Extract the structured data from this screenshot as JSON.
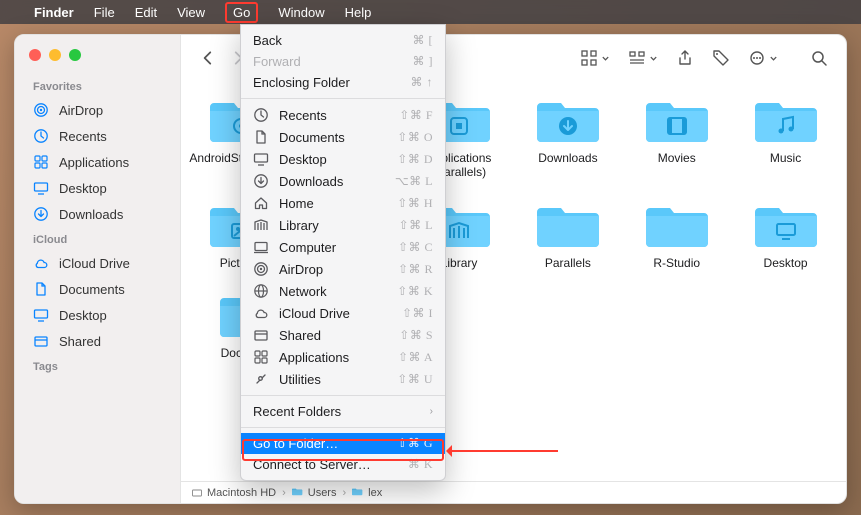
{
  "menubar": {
    "app": "Finder",
    "items": [
      "File",
      "Edit",
      "View",
      "Go",
      "Window",
      "Help"
    ]
  },
  "sidebar": {
    "favorites_label": "Favorites",
    "favorites": [
      {
        "icon": "airdrop",
        "label": "AirDrop"
      },
      {
        "icon": "clock",
        "label": "Recents"
      },
      {
        "icon": "apps",
        "label": "Applications"
      },
      {
        "icon": "desktop",
        "label": "Desktop"
      },
      {
        "icon": "download",
        "label": "Downloads"
      }
    ],
    "icloud_label": "iCloud",
    "icloud": [
      {
        "icon": "cloud",
        "label": "iCloud Drive"
      },
      {
        "icon": "doc",
        "label": "Documents"
      },
      {
        "icon": "desktop",
        "label": "Desktop"
      },
      {
        "icon": "shared",
        "label": "Shared"
      }
    ],
    "tags_label": "Tags"
  },
  "grid": {
    "row1": [
      {
        "glyph": "gear",
        "label": "AndroidStudioProjects"
      },
      {
        "glyph": "gear",
        "label": ""
      },
      {
        "glyph": "app",
        "label": "Applications (Parallels)"
      },
      {
        "glyph": "download",
        "label": "Downloads"
      },
      {
        "glyph": "movie",
        "label": "Movies"
      },
      {
        "glyph": "music",
        "label": "Music"
      }
    ],
    "row2": [
      {
        "glyph": "photo",
        "label": "Pictures"
      },
      {
        "glyph": "gear",
        "label": ""
      },
      {
        "glyph": "library",
        "label": "Library"
      },
      {
        "glyph": "none",
        "label": "Parallels"
      },
      {
        "glyph": "none",
        "label": "R-Studio"
      },
      {
        "glyph": "desktop",
        "label": "Desktop"
      }
    ],
    "row3": [
      {
        "glyph": "doc",
        "label": "Documents"
      },
      {
        "glyph": "gear",
        "label": ""
      }
    ]
  },
  "pathbar": {
    "items": [
      "Macintosh HD",
      "Users",
      "lex"
    ]
  },
  "menu": {
    "top": [
      {
        "label": "Back",
        "sc": "⌘ ["
      },
      {
        "label": "Forward",
        "sc": "⌘ ]",
        "dis": true
      },
      {
        "label": "Enclosing Folder",
        "sc": "⌘ ↑"
      }
    ],
    "places": [
      {
        "icon": "clock",
        "label": "Recents",
        "sc": "⇧⌘ F"
      },
      {
        "icon": "doc",
        "label": "Documents",
        "sc": "⇧⌘ O"
      },
      {
        "icon": "desktop",
        "label": "Desktop",
        "sc": "⇧⌘ D"
      },
      {
        "icon": "download",
        "label": "Downloads",
        "sc": "⌥⌘ L"
      },
      {
        "icon": "home",
        "label": "Home",
        "sc": "⇧⌘ H"
      },
      {
        "icon": "library",
        "label": "Library",
        "sc": "⇧⌘ L"
      },
      {
        "icon": "computer",
        "label": "Computer",
        "sc": "⇧⌘ C"
      },
      {
        "icon": "airdrop",
        "label": "AirDrop",
        "sc": "⇧⌘ R"
      },
      {
        "icon": "globe",
        "label": "Network",
        "sc": "⇧⌘ K"
      },
      {
        "icon": "cloud",
        "label": "iCloud Drive",
        "sc": "⇧⌘ I"
      },
      {
        "icon": "shared",
        "label": "Shared",
        "sc": "⇧⌘ S"
      },
      {
        "icon": "apps",
        "label": "Applications",
        "sc": "⇧⌘ A"
      },
      {
        "icon": "util",
        "label": "Utilities",
        "sc": "⇧⌘ U"
      }
    ],
    "recent_label": "Recent Folders",
    "goto_label": "Go to Folder…",
    "goto_sc": "⇧⌘ G",
    "connect_label": "Connect to Server…",
    "connect_sc": "⌘ K"
  }
}
